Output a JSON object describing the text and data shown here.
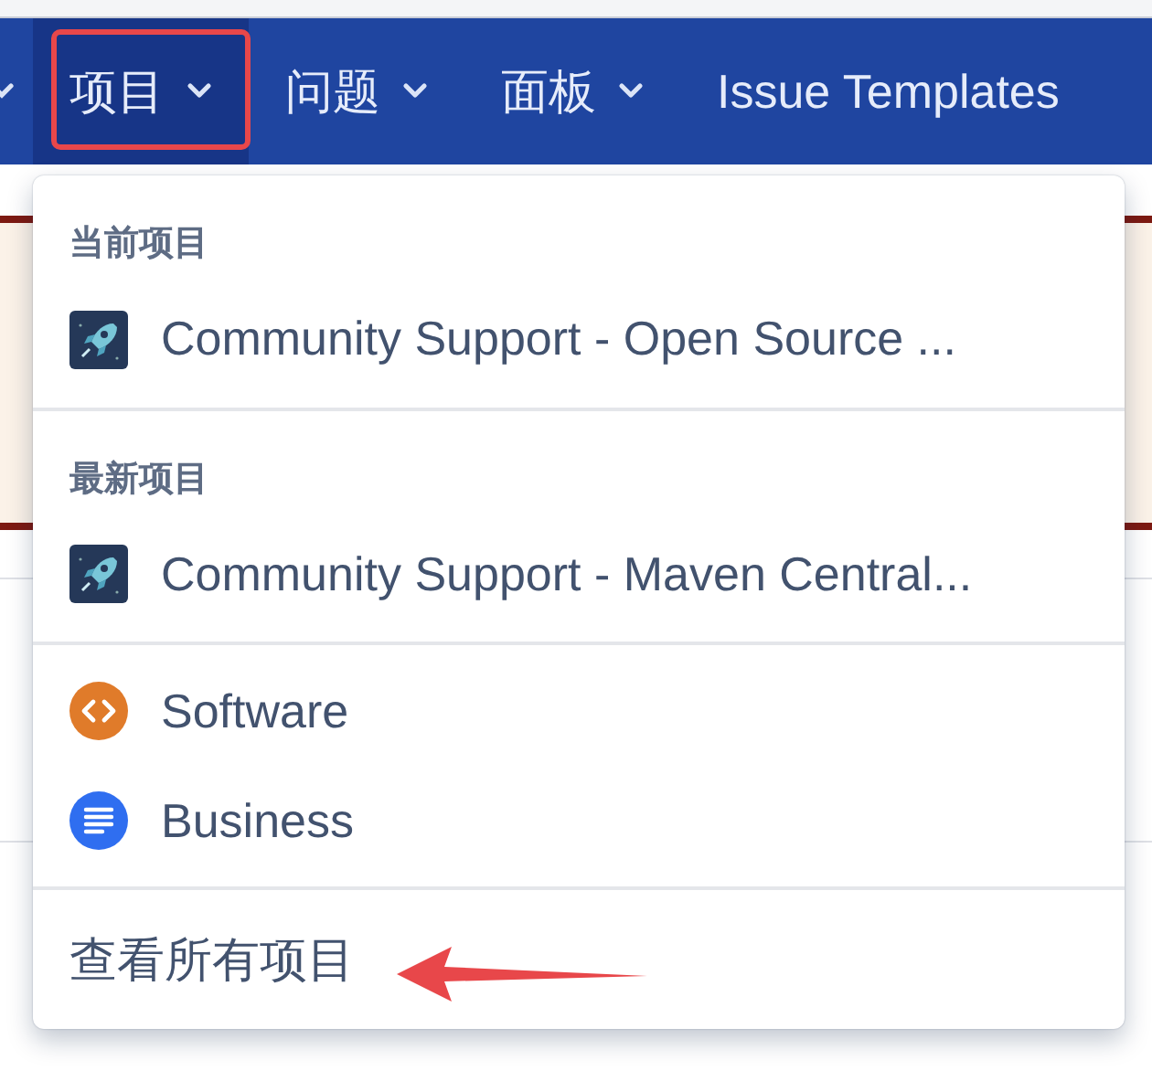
{
  "nav": {
    "items": [
      {
        "label": "项目",
        "selected": true,
        "dropdown": true
      },
      {
        "label": "问题",
        "selected": false,
        "dropdown": true
      },
      {
        "label": "面板",
        "selected": false,
        "dropdown": true
      },
      {
        "label": "Issue Templates",
        "selected": false,
        "dropdown": false
      }
    ]
  },
  "menu": {
    "sections": [
      {
        "heading": "当前项目",
        "items": [
          {
            "kind": "project",
            "label": "Community Support - Open Source ..."
          }
        ]
      },
      {
        "heading": "最新项目",
        "items": [
          {
            "kind": "project",
            "label": "Community Support - Maven Central..."
          }
        ]
      },
      {
        "items": [
          {
            "kind": "software",
            "label": "Software"
          },
          {
            "kind": "business",
            "label": "Business"
          }
        ]
      },
      {
        "items": [
          {
            "kind": "link",
            "label": "查看所有项目"
          }
        ]
      }
    ]
  }
}
